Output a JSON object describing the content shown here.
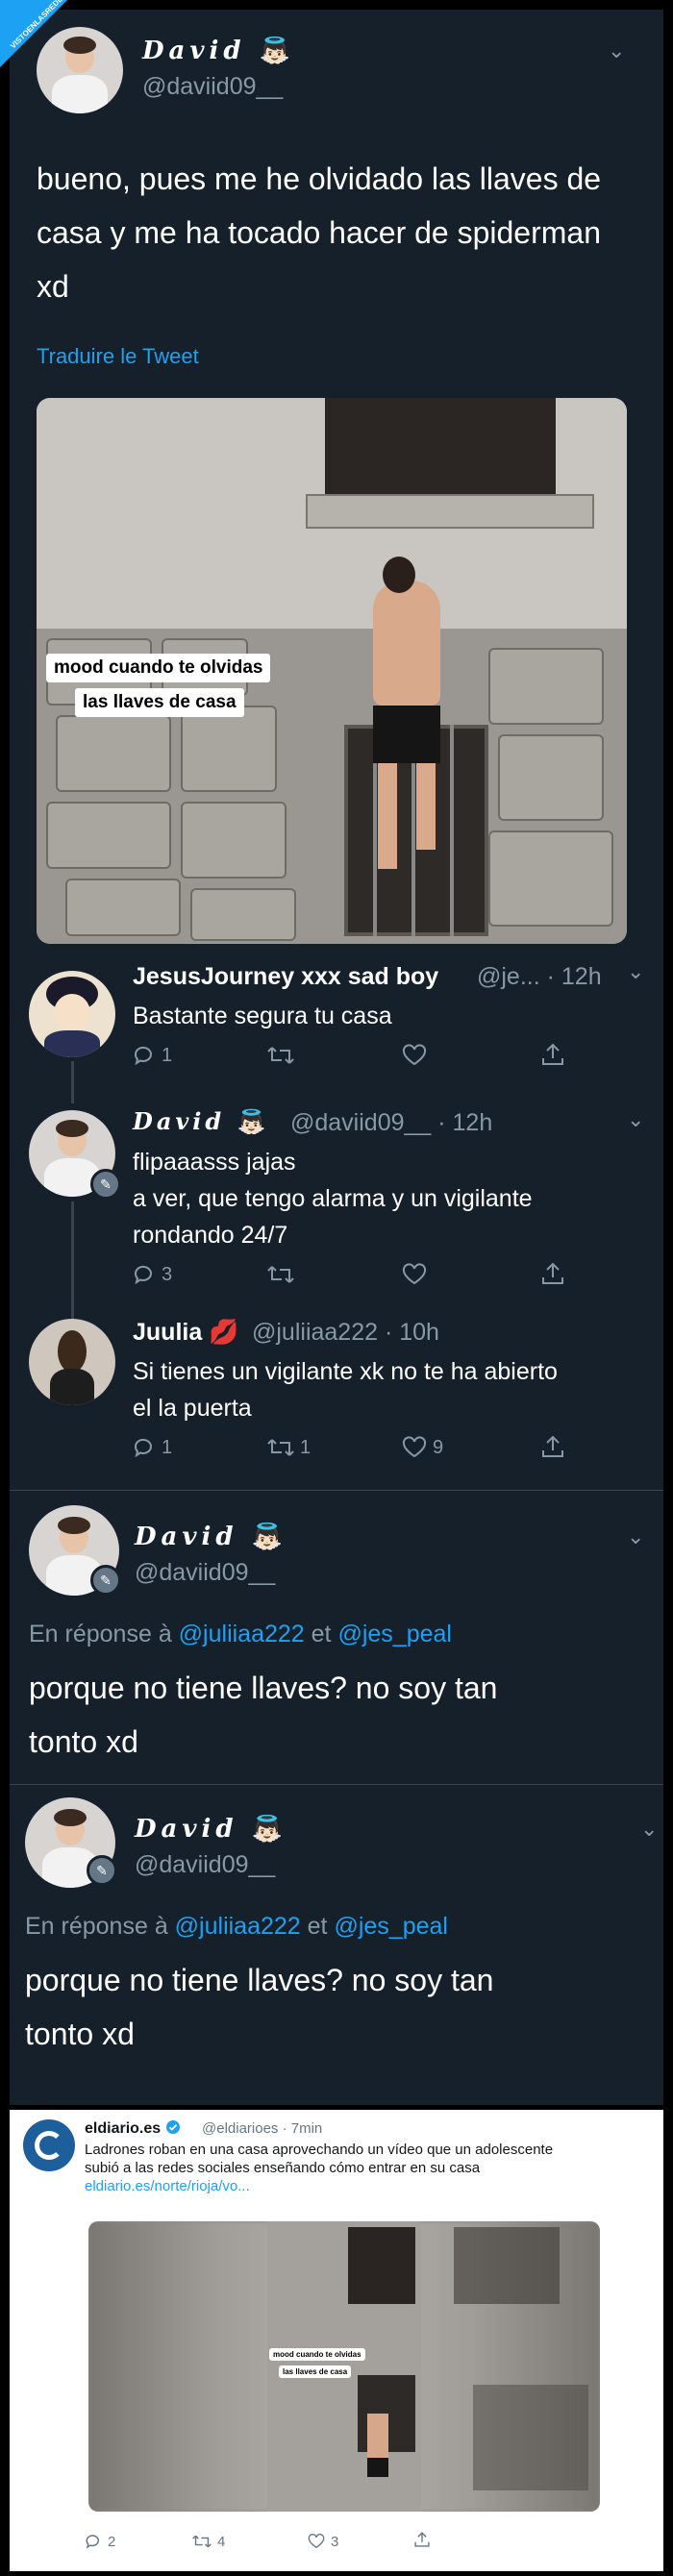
{
  "watermark": "VISTOENLASREDES",
  "tweet": {
    "name": "David",
    "emoji": "👼🏻",
    "handle": "@daviid09__",
    "text": "bueno, pues me he olvidado las llaves de casa y me ha tocado hacer de spiderman xd",
    "translate": "Traduire le Tweet",
    "caption_line1": "mood cuando te olvidas",
    "caption_line2": "las llaves de casa"
  },
  "replies": [
    {
      "name": "JesusJourney xxx sad boy",
      "meta": "@je... · 12h",
      "text": [
        "Bastante segura tu casa"
      ],
      "reply_count": "1",
      "retweet_count": "",
      "like_count": ""
    },
    {
      "name": "David",
      "emoji": "👼🏻",
      "meta": "@daviid09__ · 12h",
      "text": [
        "flipaaasss jajas",
        "a ver, que tengo alarma y un vigilante",
        "rondando 24/7"
      ],
      "reply_count": "3",
      "retweet_count": "",
      "like_count": ""
    },
    {
      "name": "Juulia",
      "emoji": "💋",
      "meta": "@juliiaa222 · 10h",
      "text": [
        "Si tienes un vigilante xk no te ha abierto",
        "el la puerta"
      ],
      "reply_count": "1",
      "retweet_count": "1",
      "like_count": "9"
    }
  ],
  "focused": [
    {
      "name": "David",
      "emoji": "👼🏻",
      "handle": "@daviid09__",
      "in_reply_prefix": "En réponse à",
      "mention1": "@juliiaa222",
      "conj": "et",
      "mention2": "@jes_peal",
      "text_line1": "porque no tiene llaves? no soy tan",
      "text_line2": "tonto xd"
    },
    {
      "name": "David",
      "emoji": "👼🏻",
      "handle": "@daviid09__",
      "in_reply_prefix": "En réponse à",
      "mention1": "@juliiaa222",
      "conj": "et",
      "mention2": "@jes_peal",
      "text_line1": "porque no tiene llaves? no soy tan",
      "text_line2": "tonto xd"
    }
  ],
  "eldiario": {
    "name": "eldiario.es",
    "meta": "@eldiarioes · 7min",
    "text_line1": "Ladrones roban en una casa aprovechando un vídeo que un adolescente",
    "text_line2": "subió a las redes sociales enseñando cómo entrar en su casa",
    "link": "eldiario.es/norte/rioja/vo...",
    "caption_line1": "mood cuando te olvidas",
    "caption_line2": "las llaves de casa",
    "reply_count": "2",
    "retweet_count": "4",
    "like_count": "3"
  },
  "colors": {
    "bg": "#15202b",
    "accent": "#1da1f2",
    "muted": "#8899a6",
    "like_red": "#e0245e"
  },
  "icons": [
    "chevron-down-icon",
    "reply-icon",
    "retweet-icon",
    "like-icon",
    "share-icon",
    "verified-icon",
    "pen-icon"
  ]
}
